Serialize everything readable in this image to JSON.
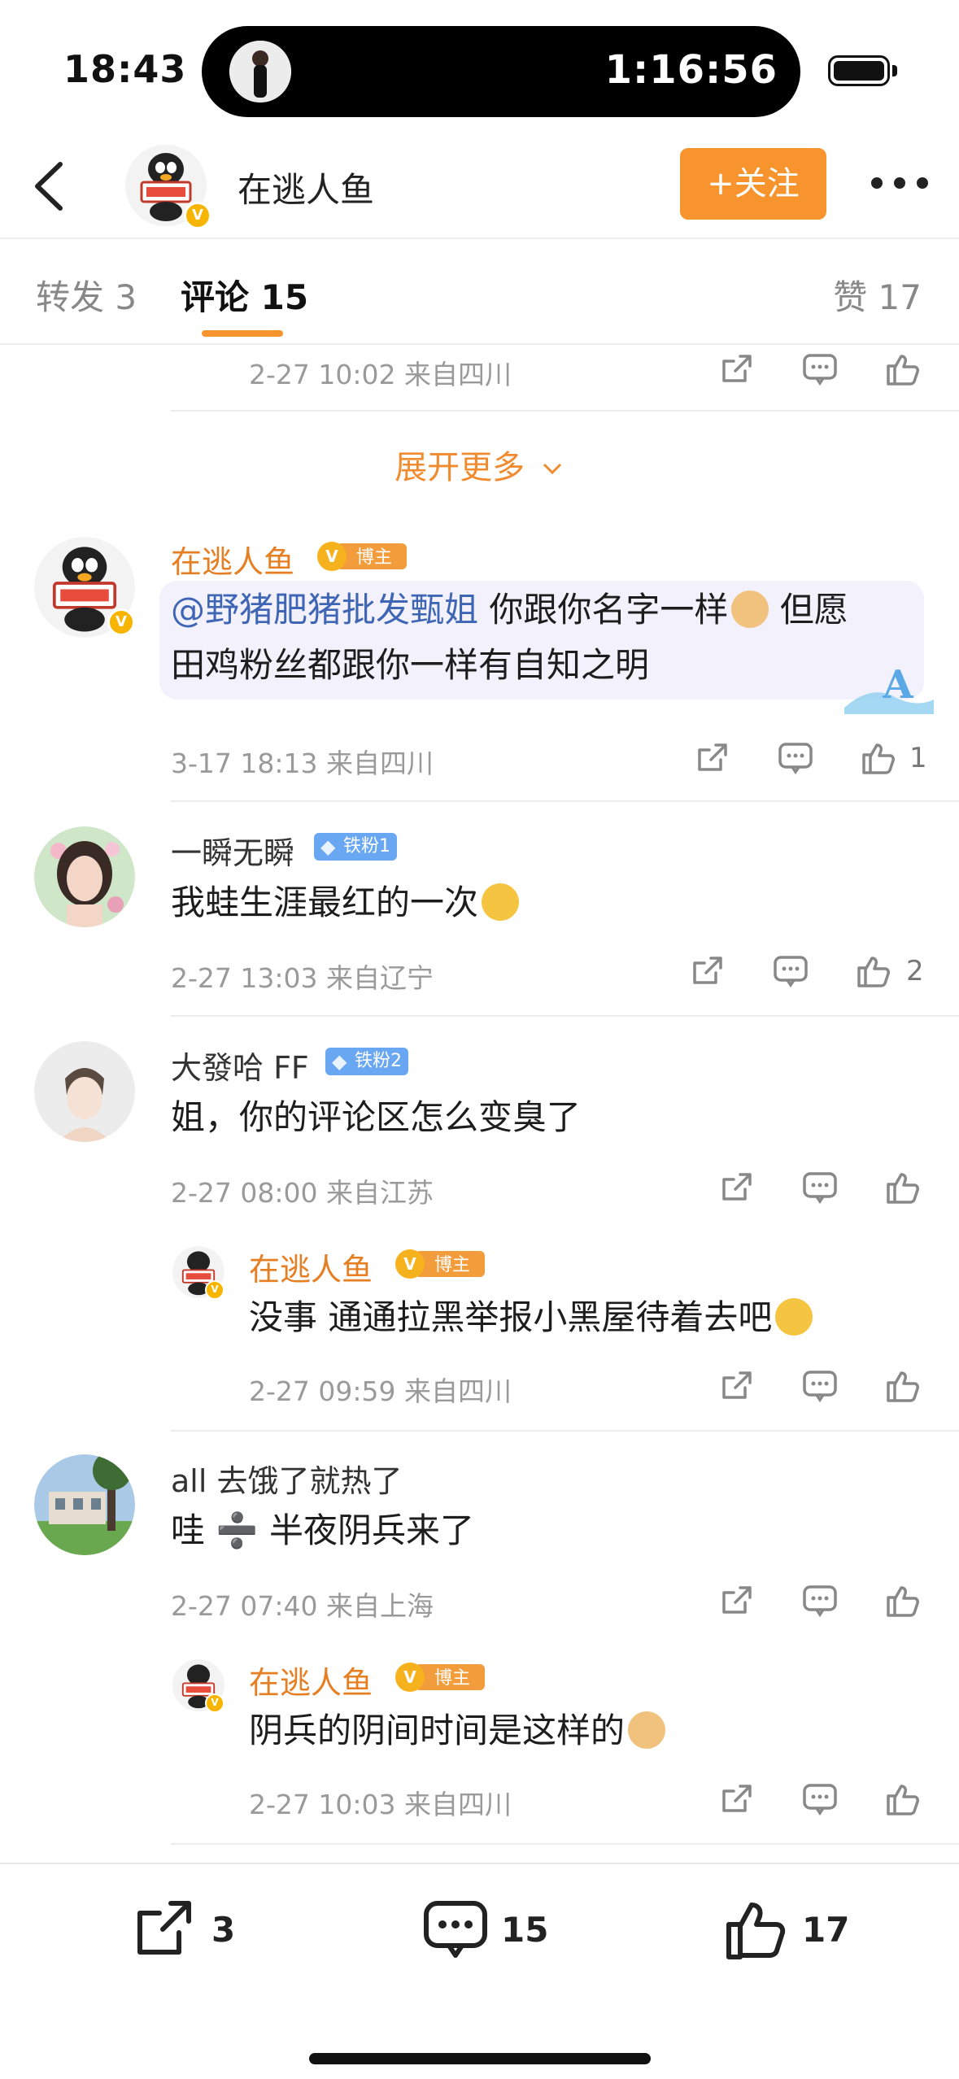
{
  "status_bar": {
    "time": "18:43",
    "timer": "1:16:56"
  },
  "nav": {
    "title": "在逃人鱼",
    "follow_label": "+关注"
  },
  "tabs": {
    "repost": "转发 3",
    "comment": "评论 15",
    "like": "赞 17"
  },
  "top_reply": {
    "meta": "2-27 10:02 来自四川"
  },
  "expand_more": "展开更多",
  "owner_badge_label": "博主",
  "comments": [
    {
      "name": "在逃人鱼",
      "is_owner": true,
      "mention": "@野猪肥猪批发甄姐",
      "text_line1": " 你跟你名字一样",
      "text_line1b": " 但愿",
      "text_line2": "田鸡粉丝都跟你一样有自知之明",
      "meta": "3-17 18:13 来自四川",
      "likes": "1"
    },
    {
      "name": "一瞬无瞬",
      "badge": "铁粉1",
      "text": "我蛙生涯最红的一次",
      "meta": "2-27 13:03 来自辽宁",
      "likes": "2"
    },
    {
      "name": "大發哈 FF",
      "badge": "铁粉2",
      "text": "姐，你的评论区怎么变臭了",
      "meta": "2-27 08:00 来自江苏",
      "reply": {
        "name": "在逃人鱼",
        "text": "没事 通通拉黑举报小黑屋待着去吧",
        "meta": "2-27 09:59 来自四川"
      }
    },
    {
      "name": "all 去饿了就热了",
      "text": "哇 ➗ 半夜阴兵来了",
      "meta": "2-27 07:40 来自上海",
      "reply": {
        "name": "在逃人鱼",
        "text": "阴兵的阴间时间是这样的",
        "meta": "2-27 10:03 来自四川"
      }
    }
  ],
  "bottom_bar": {
    "repost_count": "3",
    "comment_count": "15",
    "like_count": "17"
  },
  "colors": {
    "accent": "#f7942d",
    "owner_name": "#e67e22",
    "mention": "#3f66b5",
    "fan_badge": "#6aa7f2"
  }
}
